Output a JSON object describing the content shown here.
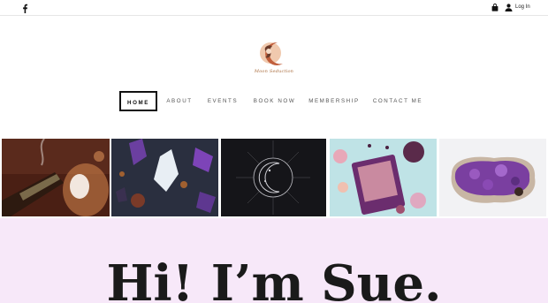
{
  "topbar": {
    "social_icon": "facebook-icon",
    "cart_icon": "shopping-bag-icon",
    "user_icon": "user-icon",
    "login_label": "Log In"
  },
  "logo": {
    "text": "Moon Seduction",
    "icon": "crescent-moon-logo"
  },
  "nav": {
    "items": [
      {
        "label": "HOME",
        "active": true
      },
      {
        "label": "ABOUT",
        "active": false
      },
      {
        "label": "EVENTS",
        "active": false
      },
      {
        "label": "BOOK NOW",
        "active": false
      },
      {
        "label": "MEMBERSHIP",
        "active": false
      },
      {
        "label": "CONTACT ME",
        "active": false
      }
    ]
  },
  "gallery": {
    "images": [
      {
        "name": "sage-smudge-photo"
      },
      {
        "name": "crystals-photo"
      },
      {
        "name": "moon-illustration-photo"
      },
      {
        "name": "oracle-cards-photo"
      },
      {
        "name": "amethyst-geode-photo"
      }
    ]
  },
  "hero": {
    "title": "Hi! I’m Sue."
  },
  "colors": {
    "hero_background": "#f7e8f9",
    "accent": "#a86a3a"
  }
}
